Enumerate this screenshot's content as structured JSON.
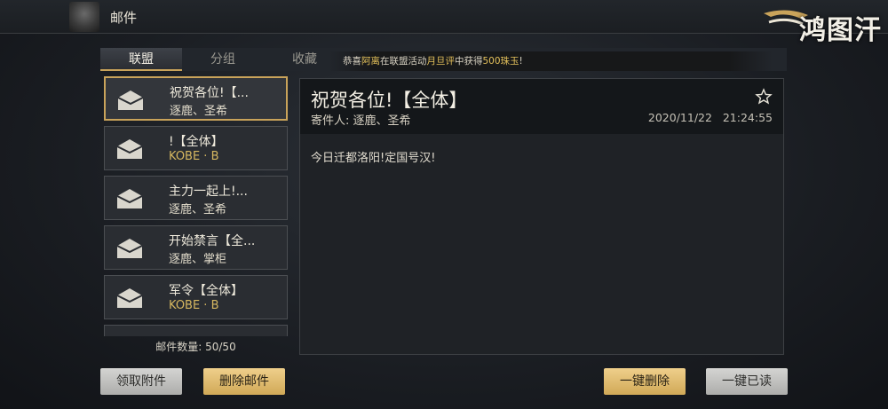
{
  "header": {
    "title": "邮件",
    "logo_text": "鸿图汗"
  },
  "tabs": [
    {
      "label": "联盟",
      "active": true
    },
    {
      "label": "分组",
      "active": false
    },
    {
      "label": "收藏",
      "active": false
    }
  ],
  "notice": {
    "prefix": "恭喜",
    "player": "阿离",
    "middle": "在联盟活动",
    "activity": "月旦评",
    "suffix": "中获得",
    "reward": "500珠玉",
    "end": "!"
  },
  "mail_list": [
    {
      "subject": "祝贺各位!【...",
      "from": "逐鹿、圣希",
      "selected": true,
      "from_color": "#e2dccb"
    },
    {
      "subject": "!【全体】",
      "from": "KOBE · B",
      "selected": false,
      "from_color": "#d6b760"
    },
    {
      "subject": "主力一起上!...",
      "from": "逐鹿、圣希",
      "selected": false,
      "from_color": "#e2dccb"
    },
    {
      "subject": "开始禁言【全...",
      "from": "逐鹿、掌柜",
      "selected": false,
      "from_color": "#e2dccb"
    },
    {
      "subject": "军令【全体】",
      "from": "KOBE · B",
      "selected": false,
      "from_color": "#d6b760"
    },
    {
      "subject": "",
      "from": "",
      "selected": false,
      "from_color": "#e2dccb"
    }
  ],
  "mail_count": "邮件数量: 50/50",
  "content": {
    "title": "祝贺各位!【全体】",
    "sender": "寄件人: 逐鹿、圣希",
    "date": "2020/11/22",
    "time": "21:24:55",
    "body": "今日迁都洛阳!定国号汉!"
  },
  "buttons": {
    "collect": "领取附件",
    "delete": "删除邮件",
    "delete_all": "一键删除",
    "read_all": "一键已读"
  },
  "colors": {
    "accent_gold": "#c9a35a",
    "highlight": "#e4c15b"
  }
}
